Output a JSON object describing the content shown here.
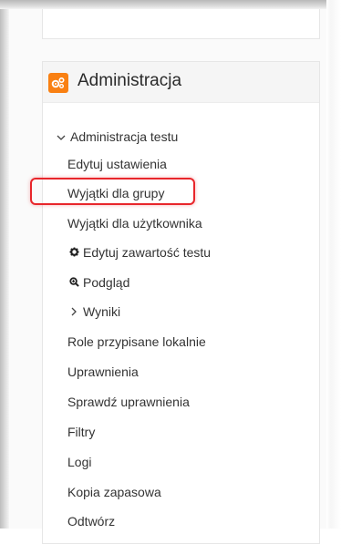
{
  "admin_block": {
    "title": "Administracja",
    "icon": "cogs-icon",
    "accent_color": "#f98012"
  },
  "menu": {
    "section_label": "Administracja testu",
    "items": [
      "Edytuj ustawienia",
      "Wyjątki dla grupy",
      "Wyjątki dla użytkownika",
      "Edytuj zawartość testu",
      "Podgląd",
      "Wyniki",
      "Role przypisane lokalnie",
      "Uprawnienia",
      "Sprawdź uprawnienia",
      "Filtry",
      "Logi",
      "Kopia zapasowa",
      "Odtwórz"
    ]
  },
  "highlight": {
    "target": "Wyjątki dla grupy",
    "color": "#e8262b"
  }
}
